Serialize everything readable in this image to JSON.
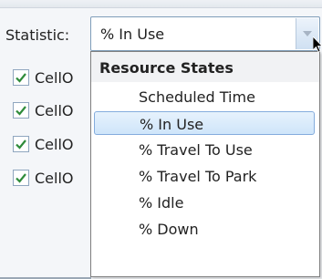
{
  "statistic": {
    "label": "Statistic:",
    "selected_value": "% In Use"
  },
  "checklist": {
    "items": [
      {
        "label": "CellO",
        "checked": true
      },
      {
        "label": "CellO",
        "checked": true
      },
      {
        "label": "CellO",
        "checked": true
      },
      {
        "label": "CellO",
        "checked": true
      }
    ]
  },
  "dropdown": {
    "group_header": "Resource States",
    "options": [
      {
        "label": "Scheduled Time",
        "selected": false
      },
      {
        "label": "% In Use",
        "selected": true
      },
      {
        "label": "% Travel To Use",
        "selected": false
      },
      {
        "label": "% Travel To Park",
        "selected": false
      },
      {
        "label": "% Idle",
        "selected": false
      },
      {
        "label": "% Down",
        "selected": false
      }
    ]
  },
  "colors": {
    "check": "#2e8b3a",
    "selection_fill": "#cfe5fa",
    "selection_border": "#84acdd",
    "combo_border": "#7f9db9"
  },
  "icons": {
    "combo_arrow": "chevron-down-icon",
    "checkbox_mark": "checkmark-icon",
    "pointer": "mouse-cursor-icon"
  }
}
